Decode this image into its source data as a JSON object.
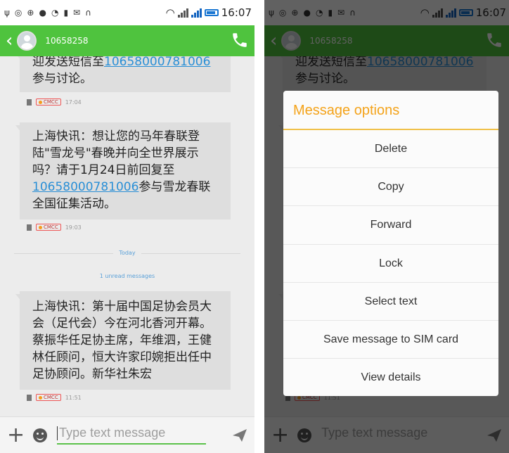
{
  "status_bar": {
    "time": "16:07",
    "icons": [
      "usb-icon",
      "notification-icon",
      "sync-icon",
      "dot-icon",
      "clock-icon",
      "sd-icon",
      "message-icon",
      "headset-icon",
      "wifi-icon",
      "signal-icon",
      "signal-icon",
      "battery-icon"
    ]
  },
  "app_bar": {
    "contact": "10658258"
  },
  "messages": [
    {
      "text_before": "迎发送短信至",
      "link": "10658000781006",
      "text_after": "参与讨论。",
      "operator": "CMCC",
      "time": "17:04"
    },
    {
      "text_before": "上海快讯：想让您的马年春联登陆\"雪龙号\"春晚并向全世界展示吗？请于1月24日前回复至",
      "link": "10658000781006",
      "text_after": "参与雪龙春联全国征集活动。",
      "operator": "CMCC",
      "time": "19:03"
    },
    {
      "text_before": "上海快讯：第十届中国足协会员大会（足代会）今在河北香河开幕。蔡振华任足协主席，年维泗，王健林任顾问，恒大许家印婉拒出任中足协顾问。新华社朱宏",
      "link": "",
      "text_after": "",
      "operator": "CMCC",
      "time": "11:51"
    }
  ],
  "day_divider": "Today",
  "unread_label": "1 unread messages",
  "composer": {
    "placeholder": "Type text message"
  },
  "dialog": {
    "title": "Message options",
    "options": [
      "Delete",
      "Copy",
      "Forward",
      "Lock",
      "Select text",
      "Save message to SIM card",
      "View details"
    ]
  },
  "colors": {
    "app_bar": "#4fc33e",
    "link": "#2a8fd6",
    "dialog_title": "#f4a31a",
    "dialog_rule": "#f0c048"
  }
}
